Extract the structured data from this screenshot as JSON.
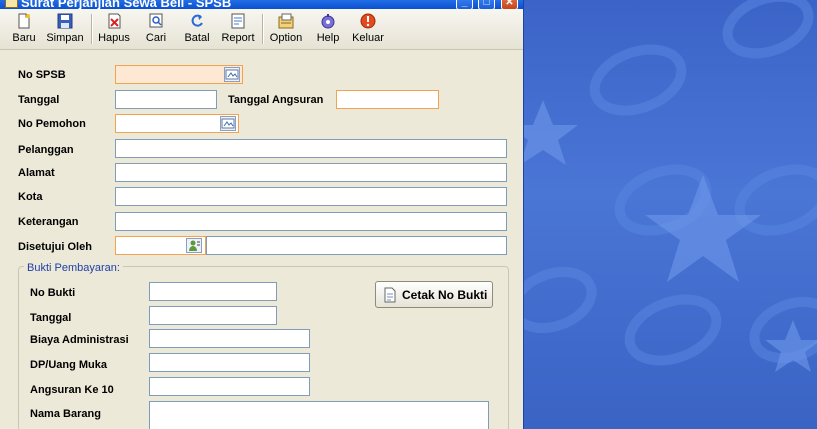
{
  "window": {
    "title": "Surat Perjanjian Sewa Beli - SPSB"
  },
  "toolbar": {
    "items": [
      {
        "label": "Baru"
      },
      {
        "label": "Simpan"
      },
      {
        "label": "Hapus"
      },
      {
        "label": "Cari"
      },
      {
        "label": "Batal"
      },
      {
        "label": "Report"
      },
      {
        "label": "Option"
      },
      {
        "label": "Help"
      },
      {
        "label": "Keluar"
      }
    ]
  },
  "form": {
    "no_spsb": {
      "label": "No SPSB",
      "value": ""
    },
    "tanggal": {
      "label": "Tanggal",
      "value": ""
    },
    "tanggal_angsuran": {
      "label": "Tanggal Angsuran",
      "value": ""
    },
    "no_pemohon": {
      "label": "No Pemohon",
      "value": ""
    },
    "pelanggan": {
      "label": "Pelanggan",
      "value": ""
    },
    "alamat": {
      "label": "Alamat",
      "value": ""
    },
    "kota": {
      "label": "Kota",
      "value": ""
    },
    "keterangan": {
      "label": "Keterangan",
      "value": ""
    },
    "disetujui_oleh": {
      "label": "Disetujui Oleh",
      "value": ""
    }
  },
  "bukti": {
    "title": "Bukti Pembayaran:",
    "no_bukti": {
      "label": "No Bukti",
      "value": ""
    },
    "tanggal": {
      "label": "Tanggal",
      "value": ""
    },
    "biaya_admin": {
      "label": "Biaya Administrasi",
      "value": ""
    },
    "dp": {
      "label": "DP/Uang Muka",
      "value": ""
    },
    "angsuran": {
      "label": "Angsuran Ke 10",
      "value": ""
    },
    "nama_barang": {
      "label": "Nama Barang",
      "value": ""
    },
    "cetak_button": "Cetak No Bukti"
  },
  "icons": {
    "baru": "new-document-icon",
    "simpan": "save-icon",
    "hapus": "delete-icon",
    "cari": "search-icon",
    "batal": "undo-icon",
    "report": "report-icon",
    "option": "option-icon",
    "help": "help-icon",
    "keluar": "exit-icon"
  },
  "colors": {
    "accent_orange": "#f2a34f",
    "window_bg": "#ece9d8",
    "desktop_blue": "#3a67c9"
  }
}
